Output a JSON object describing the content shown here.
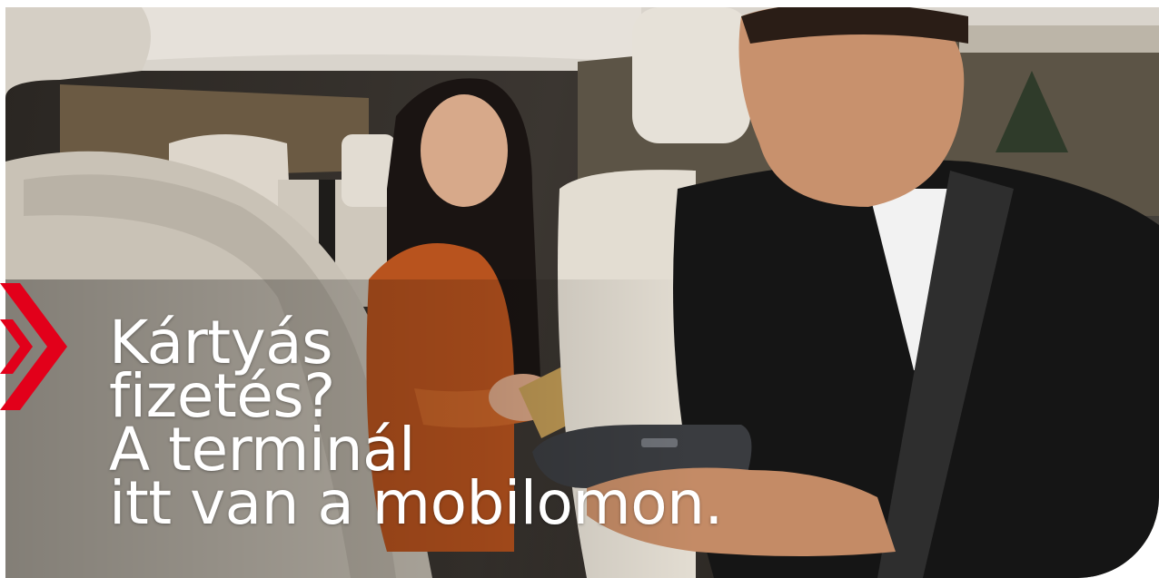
{
  "headline": {
    "line1": "Kártyás",
    "line2": "fizetés?",
    "line3": "A terminál",
    "line4": "itt van a mobilomon."
  },
  "colors": {
    "brand_red": "#e2001a",
    "headline_text": "#ffffff"
  },
  "icons": {
    "accent": "double-chevron-right-icon"
  }
}
